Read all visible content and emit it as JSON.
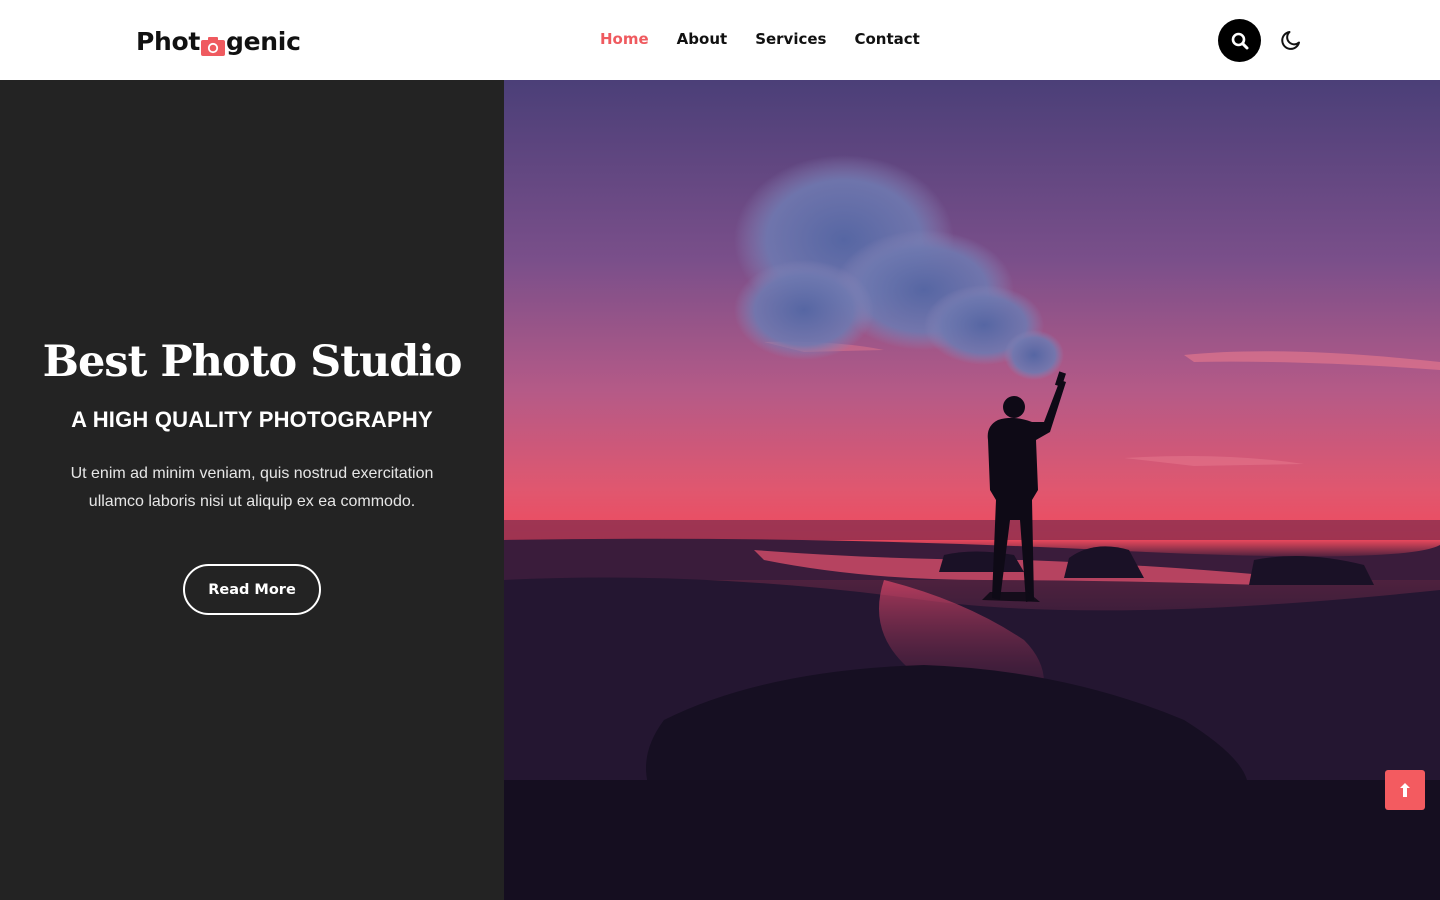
{
  "header": {
    "logo_left": "Phot",
    "logo_right": "genic",
    "nav": [
      {
        "label": "Home",
        "active": true
      },
      {
        "label": "About",
        "active": false
      },
      {
        "label": "Services",
        "active": false
      },
      {
        "label": "Contact",
        "active": false
      }
    ],
    "search_icon": "search-icon",
    "theme_icon": "moon-icon"
  },
  "hero": {
    "title": "Best Photo Studio",
    "subtitle": "A HIGH QUALITY PHOTOGRAPHY",
    "text": "Ut enim ad minim veniam, quis nostrud exercitation ullamco laboris nisi ut aliquip ex ea commodo.",
    "button_label": "Read More"
  },
  "scroll_top_icon": "arrow-up-icon",
  "colors": {
    "accent": "#ef5a5f",
    "hero_panel": "#232323",
    "header_bg": "#ffffff",
    "text_dark": "#111111"
  }
}
